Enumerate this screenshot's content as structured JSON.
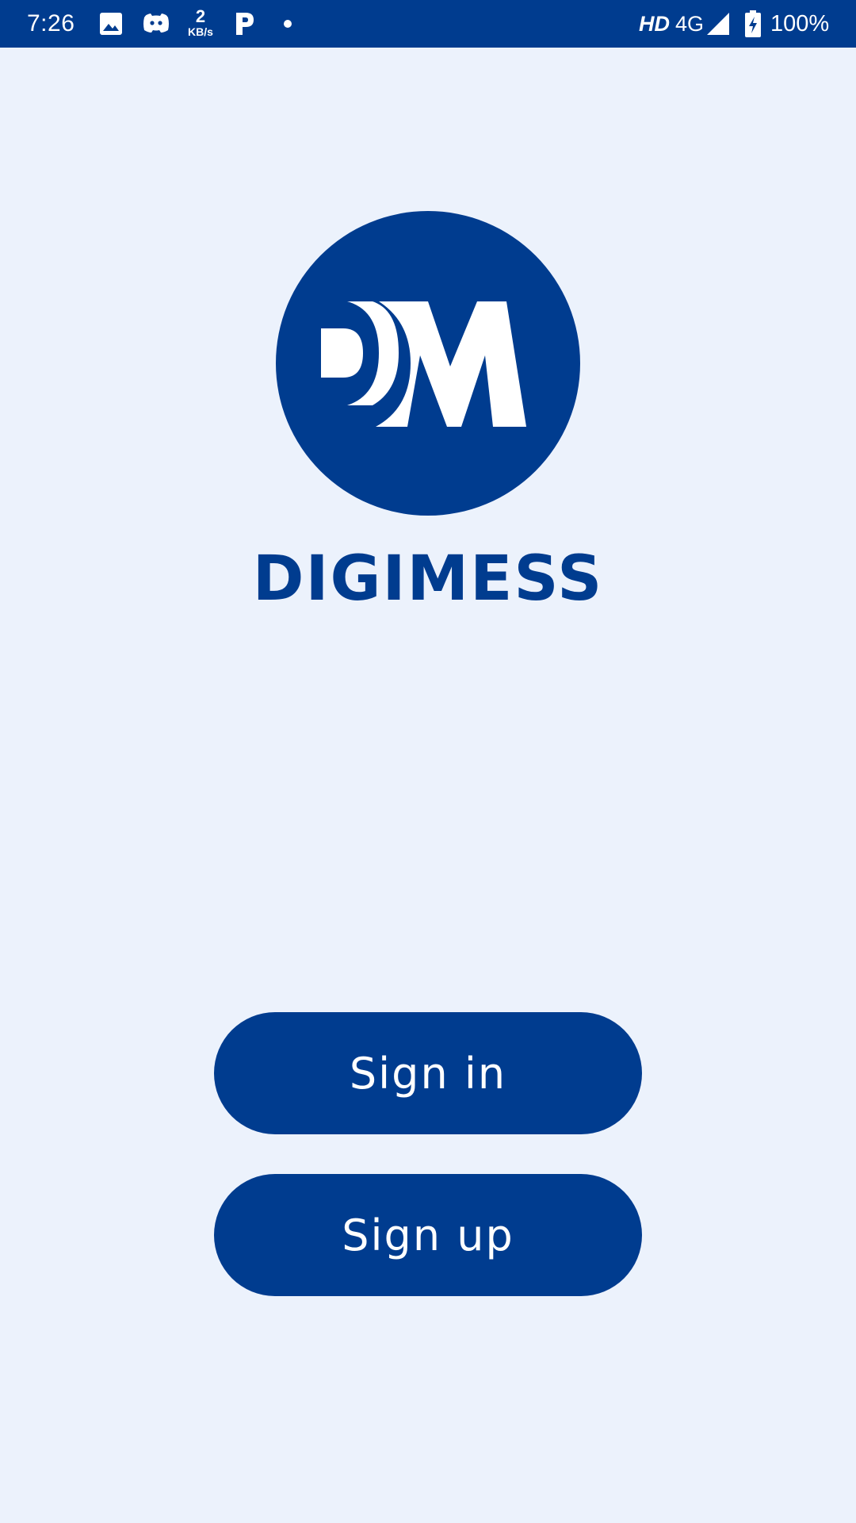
{
  "status_bar": {
    "time": "7:26",
    "speed_value": "2",
    "speed_unit": "KB/s",
    "hd": "HD",
    "network": "4G",
    "battery": "100%",
    "icons": [
      "image-icon",
      "discord-icon",
      "p-app-icon",
      "notification-dot-icon",
      "signal-icon",
      "battery-charging-icon"
    ]
  },
  "brand": {
    "logo_text": "DM",
    "name": "DIGIMESS",
    "color": "#003C8F",
    "background": "#ECF2FC"
  },
  "actions": {
    "signin_label": "Sign in",
    "signup_label": "Sign up"
  }
}
